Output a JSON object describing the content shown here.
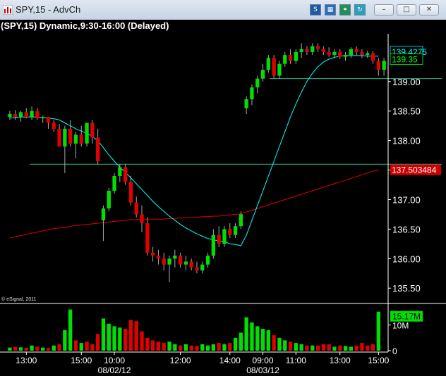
{
  "window": {
    "title": "SPY,15 - AdvCh",
    "toolbar_icons": [
      "chart-type-icon",
      "layout-icon",
      "link-icon",
      "refresh-icon"
    ],
    "controls": {
      "minimize": "–",
      "maximize": "□",
      "close": "✕"
    }
  },
  "chart_data": {
    "type": "candlestick",
    "title": "(SPY,15) Dynamic,9:30-16:00 (Delayed)",
    "watermark": "© eSignal, 2011",
    "price_axis": {
      "ylim": [
        135.3,
        140.0
      ],
      "ticks": [
        "139.00",
        "138.50",
        "138.00",
        "137.50",
        "137.00",
        "136.50",
        "136.00",
        "135.50"
      ],
      "tick_values": [
        139.0,
        138.5,
        138.0,
        137.5,
        137.0,
        136.5,
        136.0,
        135.5
      ]
    },
    "price_labels": [
      {
        "text": "139.4275",
        "value": 139.43,
        "color": "#00ffff"
      },
      {
        "text": "139.35",
        "value": 139.35,
        "color": "#00ff00"
      },
      {
        "text": "137.503484",
        "value": 137.5,
        "color": "#e00000"
      }
    ],
    "horizontal_lines": [
      {
        "value": 139.05,
        "color": "#2fae8a"
      },
      {
        "value": 137.6,
        "color": "#2fae8a"
      }
    ],
    "time_axis": {
      "ticks": [
        "13:00",
        "15:00",
        "10:00",
        "12:00",
        "14:00",
        "09:00",
        "11:00",
        "13:00",
        "15:00"
      ],
      "dates": [
        "08/02/12",
        "08/03/12"
      ]
    },
    "candles": [
      [
        138.4,
        138.5,
        138.35,
        138.45
      ],
      [
        138.45,
        138.52,
        138.35,
        138.4
      ],
      [
        138.4,
        138.5,
        138.32,
        138.48
      ],
      [
        138.48,
        138.55,
        138.38,
        138.4
      ],
      [
        138.4,
        138.58,
        138.35,
        138.5
      ],
      [
        138.5,
        138.55,
        138.35,
        138.38
      ],
      [
        138.38,
        138.42,
        138.3,
        138.4
      ],
      [
        138.4,
        138.35,
        138.2,
        138.3
      ],
      [
        138.3,
        138.35,
        138.15,
        138.2
      ],
      [
        138.2,
        138.28,
        137.9,
        137.9
      ],
      [
        137.9,
        138.25,
        137.45,
        138.2
      ],
      [
        138.2,
        138.35,
        137.9,
        137.95
      ],
      [
        137.95,
        138.15,
        137.7,
        138.1
      ],
      [
        138.1,
        138.25,
        137.9,
        137.95
      ],
      [
        137.95,
        138.3,
        137.9,
        138.3
      ],
      [
        138.3,
        138.35,
        137.95,
        138.05
      ],
      [
        138.05,
        138.2,
        137.6,
        137.65
      ],
      [
        136.65,
        136.9,
        136.3,
        136.85
      ],
      [
        136.85,
        137.2,
        136.8,
        137.15
      ],
      [
        137.15,
        137.45,
        137.1,
        137.4
      ],
      [
        137.4,
        137.6,
        137.3,
        137.55
      ],
      [
        137.55,
        137.6,
        137.25,
        137.3
      ],
      [
        137.3,
        137.4,
        136.9,
        136.95
      ],
      [
        136.95,
        137.05,
        136.7,
        136.75
      ],
      [
        136.75,
        136.9,
        136.45,
        136.6
      ],
      [
        136.6,
        136.7,
        136.05,
        136.1
      ],
      [
        136.1,
        136.2,
        135.95,
        136.05
      ],
      [
        136.05,
        136.15,
        135.9,
        136.0
      ],
      [
        136.0,
        136.1,
        135.8,
        135.9
      ],
      [
        135.9,
        136.05,
        135.6,
        136.0
      ],
      [
        136.0,
        136.15,
        135.85,
        136.05
      ],
      [
        136.05,
        136.1,
        135.85,
        135.9
      ],
      [
        135.9,
        136.05,
        135.8,
        135.95
      ],
      [
        135.95,
        136.0,
        135.8,
        135.85
      ],
      [
        135.85,
        135.95,
        135.75,
        135.8
      ],
      [
        135.8,
        135.95,
        135.75,
        135.9
      ],
      [
        135.9,
        136.1,
        135.85,
        136.05
      ],
      [
        136.05,
        136.5,
        136.0,
        136.4
      ],
      [
        136.4,
        136.55,
        136.2,
        136.25
      ],
      [
        136.25,
        136.55,
        136.2,
        136.5
      ],
      [
        136.5,
        136.6,
        136.35,
        136.4
      ],
      [
        136.4,
        136.6,
        136.35,
        136.55
      ],
      [
        136.55,
        136.8,
        136.5,
        136.75
      ],
      [
        138.55,
        138.75,
        138.45,
        138.7
      ],
      [
        138.7,
        138.95,
        138.6,
        138.9
      ],
      [
        138.9,
        139.1,
        138.8,
        139.05
      ],
      [
        139.05,
        139.3,
        139.0,
        139.2
      ],
      [
        139.2,
        139.45,
        139.15,
        139.4
      ],
      [
        139.4,
        139.45,
        139.05,
        139.1
      ],
      [
        139.1,
        139.35,
        139.05,
        139.3
      ],
      [
        139.3,
        139.5,
        139.25,
        139.45
      ],
      [
        139.45,
        139.55,
        139.3,
        139.35
      ],
      [
        139.35,
        139.55,
        139.3,
        139.5
      ],
      [
        139.5,
        139.65,
        139.4,
        139.55
      ],
      [
        139.55,
        139.6,
        139.45,
        139.5
      ],
      [
        139.5,
        139.65,
        139.45,
        139.6
      ],
      [
        139.6,
        139.65,
        139.5,
        139.55
      ],
      [
        139.55,
        139.6,
        139.45,
        139.5
      ],
      [
        139.5,
        139.58,
        139.42,
        139.45
      ],
      [
        139.45,
        139.55,
        139.4,
        139.5
      ],
      [
        139.5,
        139.55,
        139.38,
        139.42
      ],
      [
        139.42,
        139.5,
        139.35,
        139.45
      ],
      [
        139.45,
        139.58,
        139.4,
        139.55
      ],
      [
        139.55,
        139.6,
        139.45,
        139.5
      ],
      [
        139.5,
        139.55,
        139.4,
        139.45
      ],
      [
        139.45,
        139.52,
        139.4,
        139.48
      ],
      [
        139.48,
        139.52,
        139.3,
        139.35
      ],
      [
        139.35,
        139.4,
        139.1,
        139.2
      ],
      [
        139.2,
        139.4,
        139.1,
        139.35
      ]
    ],
    "ma_cyan": [
      138.38,
      138.39,
      138.4,
      138.4,
      138.4,
      138.4,
      138.39,
      138.38,
      138.37,
      138.35,
      138.3,
      138.25,
      138.2,
      138.16,
      138.12,
      138.07,
      138.0,
      137.88,
      137.76,
      137.65,
      137.55,
      137.46,
      137.37,
      137.27,
      137.17,
      137.07,
      136.97,
      136.88,
      136.8,
      136.72,
      136.65,
      136.58,
      136.52,
      136.47,
      136.42,
      136.38,
      136.34,
      136.32,
      136.3,
      136.29,
      136.25,
      136.24,
      136.22,
      136.4,
      136.65,
      136.9,
      137.15,
      137.4,
      137.65,
      137.9,
      138.15,
      138.4,
      138.62,
      138.82,
      139.0,
      139.14,
      139.25,
      139.33,
      139.38,
      139.41,
      139.43,
      139.44,
      139.44,
      139.44,
      139.44,
      139.43,
      139.43,
      139.43
    ],
    "ma_red": [
      136.35,
      136.37,
      136.39,
      136.41,
      136.43,
      136.45,
      136.47,
      136.49,
      136.51,
      136.52,
      136.53,
      136.55,
      136.56,
      136.57,
      136.58,
      136.59,
      136.6,
      136.61,
      136.62,
      136.63,
      136.64,
      136.65,
      136.66,
      136.66,
      136.67,
      136.67,
      136.67,
      136.67,
      136.67,
      136.68,
      136.68,
      136.69,
      136.69,
      136.7,
      136.7,
      136.71,
      136.71,
      136.72,
      136.72,
      136.73,
      136.74,
      136.75,
      136.76,
      136.79,
      136.82,
      136.85,
      136.88,
      136.91,
      136.94,
      136.97,
      137.0,
      137.03,
      137.06,
      137.09,
      137.12,
      137.15,
      137.18,
      137.21,
      137.24,
      137.27,
      137.3,
      137.33,
      137.36,
      137.39,
      137.42,
      137.45,
      137.48,
      137.5
    ],
    "volume": {
      "ticks": [
        "10M",
        "0"
      ],
      "tick_values": [
        10,
        0
      ],
      "max": 17,
      "last_label": "15.17M",
      "values": [
        1.2,
        1.5,
        1.3,
        1.1,
        2.0,
        1.5,
        1.2,
        1.0,
        2.0,
        2.5,
        8.0,
        16.0,
        4.0,
        3.0,
        3.5,
        2.5,
        6.5,
        12.5,
        10.5,
        9.5,
        9.0,
        8.5,
        12.0,
        11.5,
        7.5,
        5.0,
        4.0,
        3.5,
        3.0,
        3.5,
        2.5,
        2.0,
        2.5,
        2.0,
        1.8,
        2.5,
        2.0,
        2.5,
        3.0,
        2.5,
        3.0,
        5.0,
        7.0,
        13.0,
        11.0,
        9.5,
        8.5,
        8.0,
        6.0,
        5.0,
        4.0,
        3.5,
        3.0,
        2.5,
        2.0,
        2.0,
        2.0,
        2.5,
        2.5,
        1.5,
        2.0,
        1.8,
        1.5,
        2.0,
        3.0,
        2.0,
        2.5,
        15.17
      ],
      "up": [
        1,
        0,
        1,
        0,
        1,
        0,
        1,
        0,
        1,
        0,
        1,
        1,
        0,
        1,
        0,
        0,
        0,
        1,
        1,
        1,
        1,
        0,
        0,
        0,
        0,
        0,
        0,
        0,
        0,
        1,
        1,
        0,
        1,
        0,
        0,
        1,
        1,
        1,
        0,
        1,
        0,
        1,
        1,
        1,
        1,
        1,
        1,
        1,
        0,
        1,
        1,
        0,
        1,
        1,
        0,
        1,
        0,
        0,
        0,
        1,
        0,
        1,
        1,
        0,
        0,
        0,
        0,
        1
      ]
    },
    "colors": {
      "up": "#00e000",
      "down": "#e00000",
      "ma_cyan": "#00ffff",
      "ma_red": "#e00000",
      "axis": "#ffffff",
      "hline": "#2fae8a"
    }
  }
}
